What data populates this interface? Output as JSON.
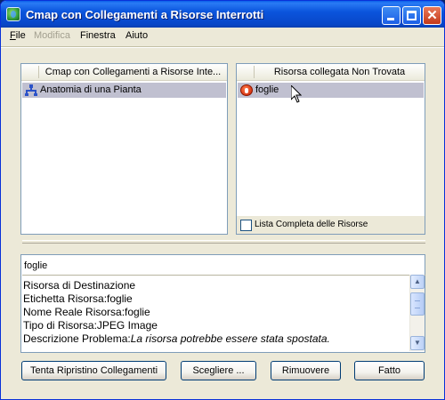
{
  "window": {
    "title": "Cmap con Collegamenti a Risorse Interrotti"
  },
  "menubar": {
    "items": [
      {
        "label": "File",
        "underline": "F",
        "enabled": true
      },
      {
        "label": "Modifica",
        "enabled": false
      },
      {
        "label": "Finestra",
        "enabled": true
      },
      {
        "label": "Aiuto",
        "enabled": true
      }
    ]
  },
  "left_panel": {
    "header": "Cmap con Collegamenti a Risorse Inte...",
    "rows": [
      {
        "label": "Anatomia di una Pianta",
        "icon": "cmap-icon",
        "selected": true
      }
    ]
  },
  "right_panel": {
    "header": "Risorsa collegata Non Trovata",
    "rows": [
      {
        "label": "foglie",
        "icon": "error-icon",
        "selected": true
      }
    ],
    "checkbox": {
      "label": "Lista Completa delle Risorse",
      "checked": false
    }
  },
  "details": {
    "name": "foglie",
    "lines": [
      "Risorsa di Destinazione",
      "Etichetta Risorsa:foglie",
      "Nome Reale Risorsa:foglie",
      "Tipo di Risorsa:JPEG Image"
    ],
    "problem_label": "Descrizione Problema:",
    "problem_text": "La risorsa potrebbe essere stata spostata."
  },
  "buttons": {
    "repair": "Tenta Ripristino Collegamenti",
    "choose": "Scegliere ...",
    "remove": "Rimuovere",
    "done": "Fatto"
  },
  "colors": {
    "titlebar": "#0846c8",
    "selection": "#c0c0d0",
    "window_bg": "#ece9d8"
  }
}
